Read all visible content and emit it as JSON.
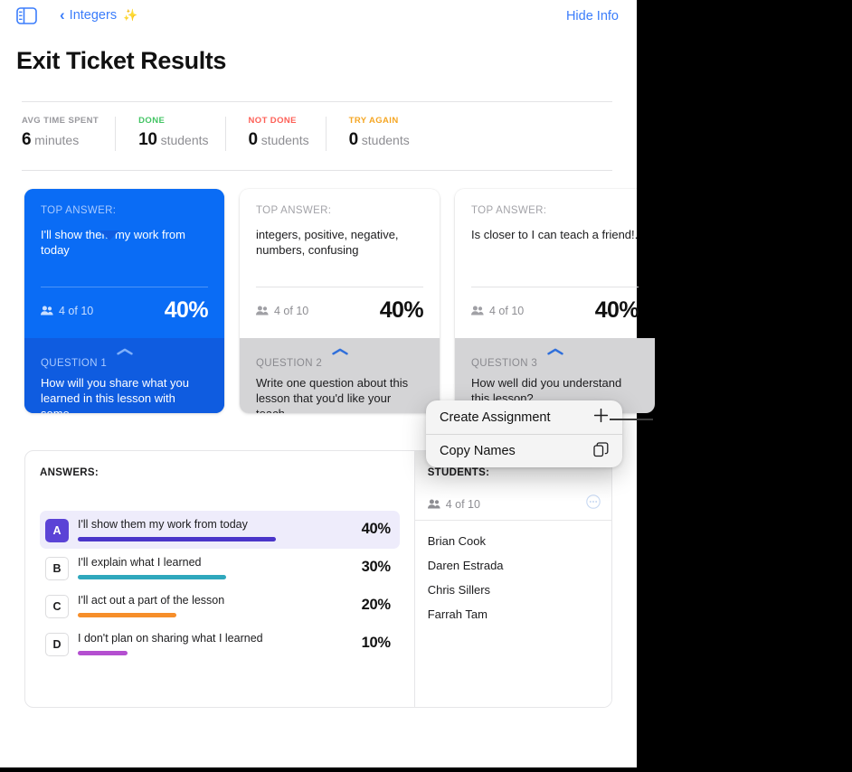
{
  "navbar": {
    "sidebar_toggle_icon": "sidebar-icon",
    "back_chevron": "‹",
    "back_label": "Integers",
    "sparkle": "✨",
    "hide_info_label": "Hide Info"
  },
  "page": {
    "title": "Exit Ticket Results"
  },
  "stats": [
    {
      "label": "AVG TIME SPENT",
      "value": "6",
      "unit": "minutes",
      "color": "#98989d"
    },
    {
      "label": "DONE",
      "value": "10",
      "unit": "students",
      "color": "#42c463"
    },
    {
      "label": "NOT DONE",
      "value": "0",
      "unit": "students",
      "color": "#fd6057"
    },
    {
      "label": "TRY AGAIN",
      "value": "0",
      "unit": "students",
      "color": "#f5a623"
    }
  ],
  "cards": [
    {
      "kicker": "TOP ANSWER:",
      "answer": "I'll show them my work from today",
      "count": "4 of 10",
      "percent": "40%",
      "qnum": "QUESTION 1",
      "qtext": "How will you share what you learned in this lesson with some…",
      "selected": true
    },
    {
      "kicker": "TOP ANSWER:",
      "answer": "integers, positive, negative, numbers, confusing",
      "count": "4 of 10",
      "percent": "40%",
      "qnum": "QUESTION 2",
      "qtext": "Write one question about this lesson that you'd like your teach…",
      "selected": false
    },
    {
      "kicker": "TOP ANSWER:",
      "answer": "Is closer to I can teach a friend!.",
      "count": "4 of 10",
      "percent": "40%",
      "qnum": "QUESTION 3",
      "qtext": "How well did you understand this lesson?",
      "selected": false
    }
  ],
  "answers_panel": {
    "title": "ANSWERS:",
    "rows": [
      {
        "badge": "A",
        "text": "I'll show them my work from today",
        "percent": "40%",
        "bar_pct": 72,
        "color": "#4a35c9",
        "highlight": true
      },
      {
        "badge": "B",
        "text": "I'll explain what I learned",
        "percent": "30%",
        "bar_pct": 54,
        "color": "#2fa8bd",
        "highlight": false
      },
      {
        "badge": "C",
        "text": "I'll act out a part of the lesson",
        "percent": "20%",
        "bar_pct": 36,
        "color": "#f68e2a",
        "highlight": false
      },
      {
        "badge": "D",
        "text": "I don't plan on sharing what I learned",
        "percent": "10%",
        "bar_pct": 18,
        "color": "#b44fd0",
        "highlight": false
      }
    ]
  },
  "students_panel": {
    "title": "STUDENTS:",
    "count": "4 of 10",
    "more_icon": "circle-ellipsis-icon",
    "names": [
      "Brian Cook",
      "Daren Estrada",
      "Chris Sillers",
      "Farrah Tam"
    ]
  },
  "popover": {
    "items": [
      {
        "label": "Create Assignment",
        "icon": "plus-icon"
      },
      {
        "label": "Copy Names",
        "icon": "copy-icon"
      }
    ]
  },
  "colors": {
    "accent_blue": "#0a6cf5",
    "link_blue": "#3b7dfb",
    "card_footer_grey": "#d4d4d6",
    "highlight_purple": "#5b43d6"
  }
}
